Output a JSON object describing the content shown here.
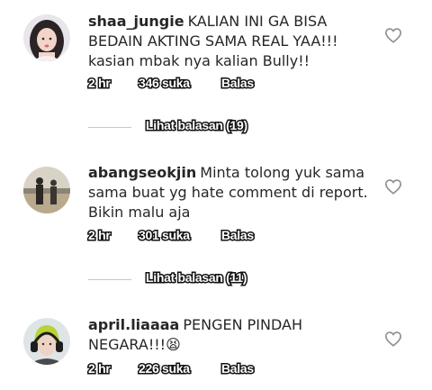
{
  "comments": [
    {
      "username": "shaa_jungie",
      "text": "KALIAN INI GA BISA BEDAIN AKTING SAMA REAL YAA!!! kasian mbak nya kalian Bully!!",
      "time": "2 hr",
      "likes": "346 suka",
      "reply": "Balas",
      "view_replies": "Lihat balasan (19)",
      "heart_icon": "heart-outline-icon"
    },
    {
      "username": "abangseokjin",
      "text": "Minta tolong yuk sama sama buat yg hate comment di report. Bikin malu aja",
      "time": "2 hr",
      "likes": "301 suka",
      "reply": "Balas",
      "view_replies": "Lihat balasan (11)",
      "heart_icon": "heart-outline-icon"
    },
    {
      "username": "april.liaaaa",
      "text": "PENGEN PINDAH NEGARA!!!😫",
      "time": "2 hr",
      "likes": "226 suka",
      "reply": "Balas",
      "heart_icon": "heart-outline-icon"
    }
  ]
}
